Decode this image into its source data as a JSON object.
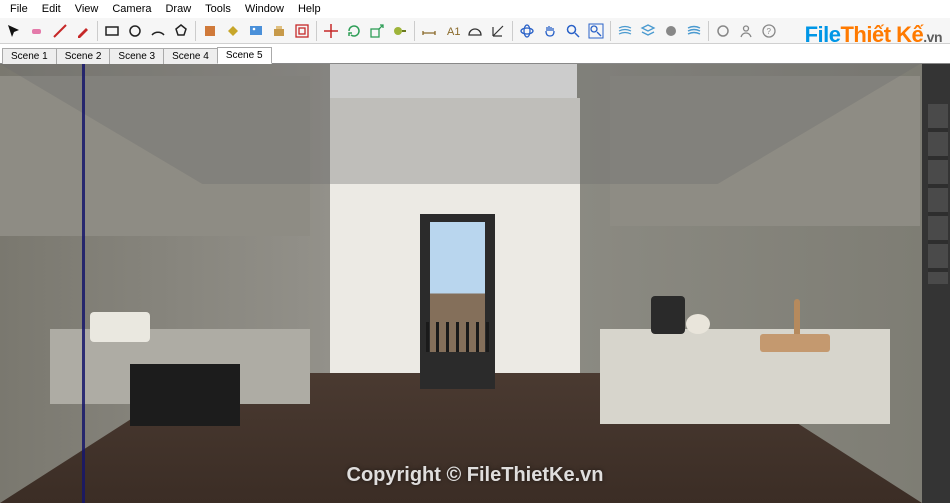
{
  "menu": {
    "items": [
      "File",
      "Edit",
      "View",
      "Camera",
      "Draw",
      "Tools",
      "Window",
      "Help"
    ]
  },
  "toolbar": {
    "icons": [
      "select-arrow",
      "eraser",
      "line",
      "pencil",
      "rectangle",
      "circle",
      "arc",
      "polygon",
      "door-component",
      "paint-bucket",
      "import-image",
      "push-pull",
      "offset",
      "move",
      "rotate",
      "scale",
      "tape-measure",
      "dimension",
      "text",
      "protractor",
      "axes",
      "orbit",
      "pan",
      "zoom",
      "zoom-extents",
      "section-plane",
      "layers",
      "shadows",
      "fog",
      "styles",
      "profile",
      "help"
    ],
    "colors": {
      "select": "#1040c0",
      "eraser": "#e070a8",
      "line": "#c72020",
      "pencil": "#c72020",
      "rect": "#1a1a1a",
      "circle": "#1a1a1a",
      "arc": "#1a1a1a",
      "poly": "#1a1a1a",
      "comp": "#d07030",
      "paint": "#c0a020",
      "image": "#3080d0",
      "push": "#c09020",
      "offset": "#c72020",
      "move": "#c72020",
      "rotate": "#209060",
      "scale": "#209060",
      "tape": "#80a020",
      "dim": "#806020",
      "text": "#806020",
      "protractor": "#1a1a1a",
      "axes": "#1a1a1a",
      "orbit": "#2060c0",
      "pan": "#2060c0",
      "zoom": "#2060c0",
      "zoomext": "#2060c0",
      "section": "#50a0d0",
      "layers": "#50a0d0",
      "shadows": "#888",
      "fog": "#50a0d0",
      "styles": "#888",
      "profile": "#888",
      "help": "#888"
    }
  },
  "tabs": {
    "items": [
      "Scene 1",
      "Scene 2",
      "Scene 3",
      "Scene 4",
      "Scene 5"
    ],
    "active_index": 4
  },
  "watermark": "Copyright © FileThietKe.vn",
  "logo": {
    "part1": "File",
    "part2": "Thiết Kế",
    "suffix": ".vn"
  }
}
